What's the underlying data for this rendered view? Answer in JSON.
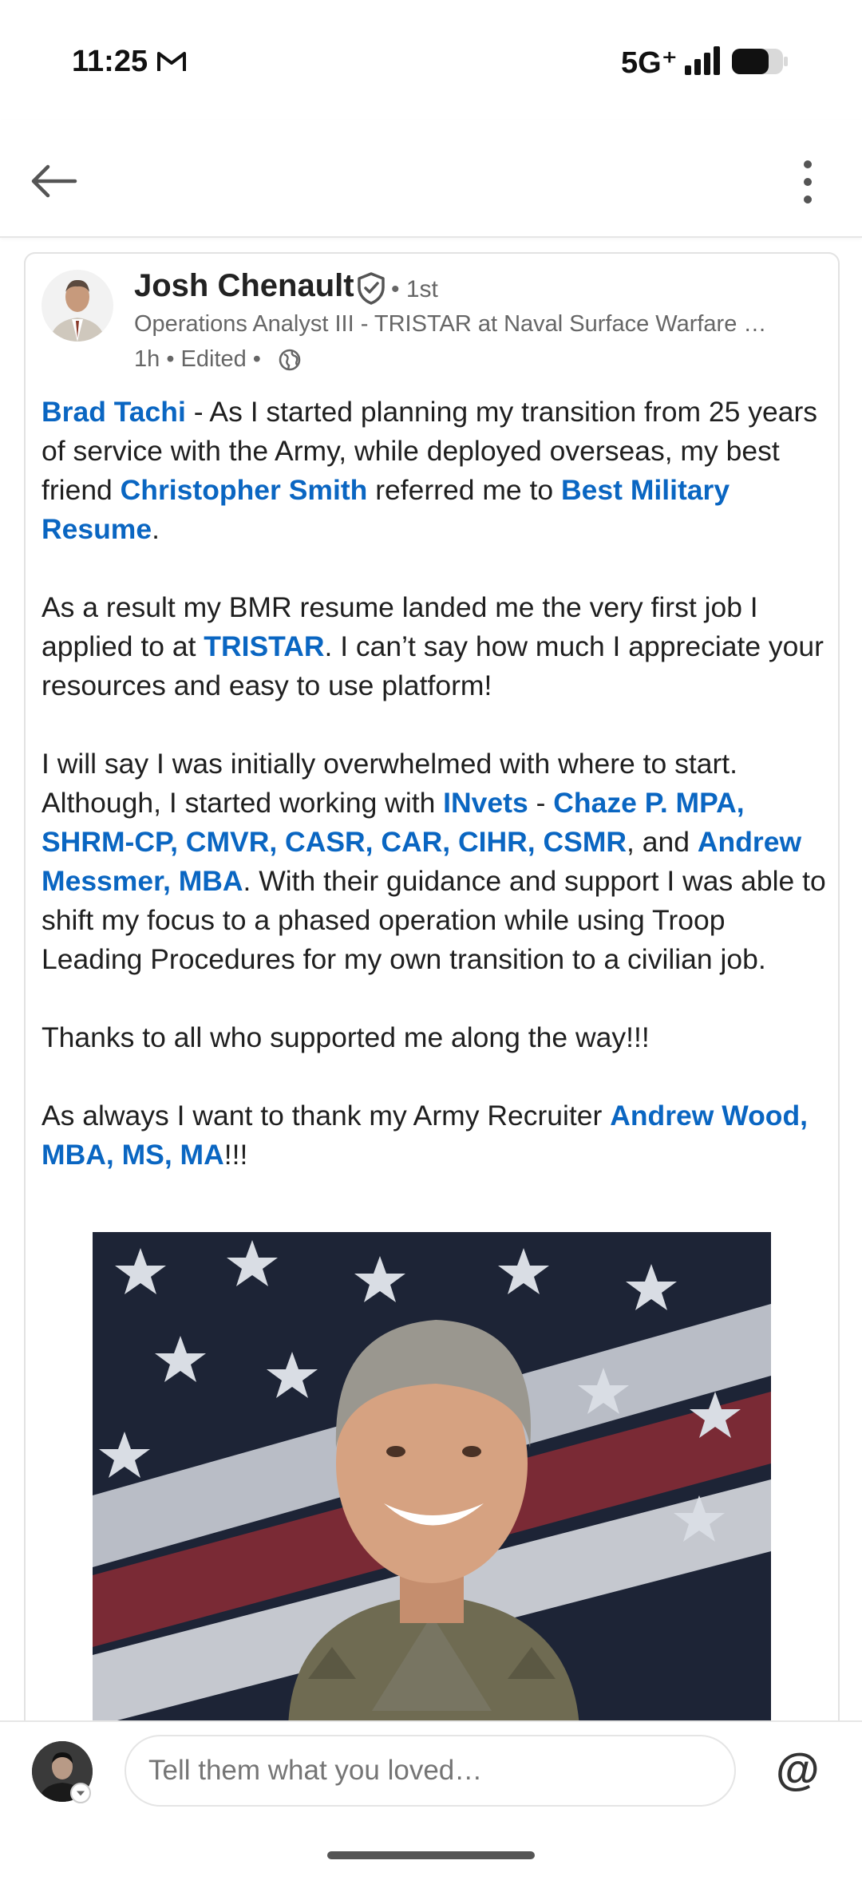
{
  "status_bar": {
    "time": "11:25",
    "network": "5G⁺",
    "icons": [
      "gmail-icon",
      "signal-icon",
      "battery-icon"
    ]
  },
  "top_bar": {
    "icons": [
      "back-arrow-icon",
      "more-vertical-icon"
    ]
  },
  "post": {
    "author": {
      "name": "Josh Chenault",
      "degree": "• 1st",
      "headline": "Operations Analyst III - TRISTAR at Naval Surface Warfare …",
      "meta": "1h • Edited •"
    },
    "body": {
      "p1": {
        "m1": "Brad Tachi",
        "t1": " - As I started planning my transition from 25 years of service with the Army, while deployed overseas, my best friend ",
        "m2": "Christopher Smith",
        "t2": " referred me to ",
        "m3": "Best Military Resume",
        "t3": "."
      },
      "p2": {
        "t1": "As a result my BMR resume landed me the very first job I applied to at ",
        "m1": "TRISTAR",
        "t2": ". I can’t say how much I appreciate your resources and easy to use platform!"
      },
      "p3": {
        "t1": "I will say I was initially overwhelmed with where to start. Although, I started working with ",
        "m1": "INvets",
        "t2": " - ",
        "m2": "Chaze P. MPA, SHRM-CP, CMVR, CASR, CAR, CIHR, CSMR",
        "t3": ", and ",
        "m3": "Andrew Messmer, MBA",
        "t4": ". With their guidance and support I was able to shift my focus to a phased operation while using Troop Leading Procedures for my own transition to a civilian job."
      },
      "p4": "Thanks to all who supported me along the way!!!",
      "p5": {
        "t1": "As always I want to thank my Army Recruiter ",
        "m1": "Andrew Wood, MBA, MS, MA",
        "t2": "!!!"
      }
    }
  },
  "comment_bar": {
    "placeholder": "Tell them what you loved…",
    "mention_symbol": "@"
  },
  "colors": {
    "link": "#0a66c2",
    "text": "#1f1f1f",
    "secondary_text": "#666666"
  }
}
